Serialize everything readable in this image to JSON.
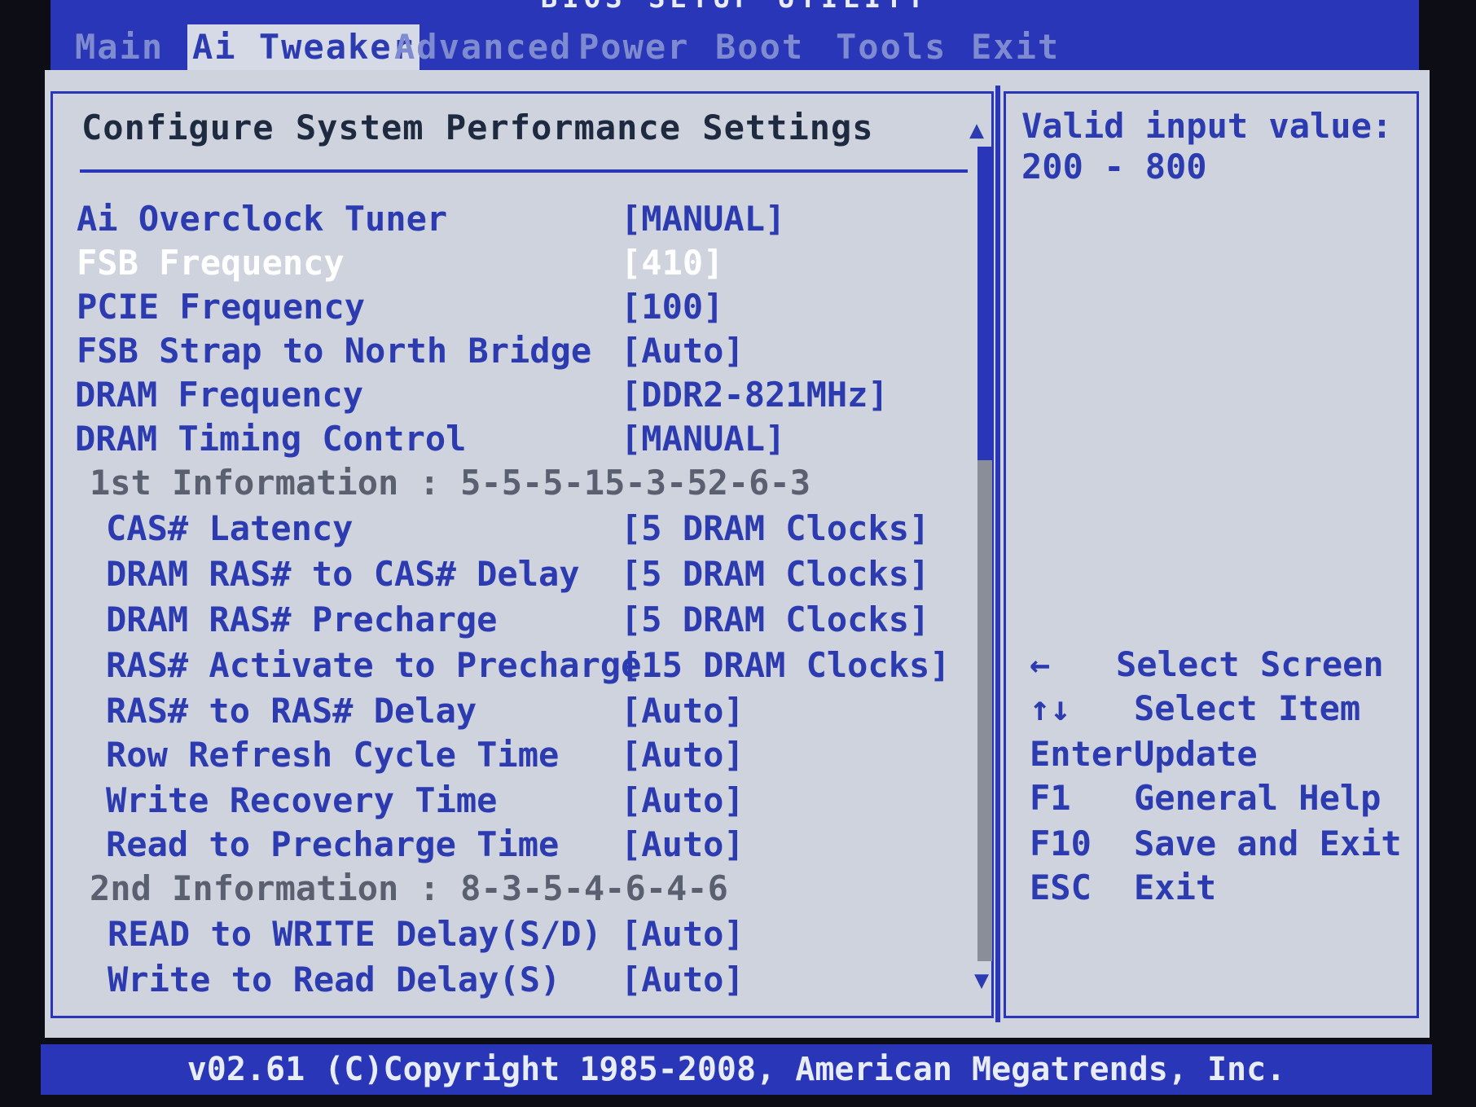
{
  "window": {
    "title": "BIOS SETUP UTILITY"
  },
  "menu": {
    "tabs": [
      {
        "label": "Main"
      },
      {
        "label": "Ai Tweaker"
      },
      {
        "label": "Advanced"
      },
      {
        "label": "Power"
      },
      {
        "label": "Boot"
      },
      {
        "label": "Tools"
      },
      {
        "label": "Exit"
      }
    ],
    "active_tab": "Ai Tweaker"
  },
  "panel": {
    "title": "Configure System Performance Settings",
    "rows": [
      {
        "label": "Ai Overclock Tuner",
        "value": "[MANUAL]"
      },
      {
        "label": "FSB Frequency",
        "value": "[410]"
      },
      {
        "label": "PCIE Frequency",
        "value": "[100]"
      },
      {
        "label": "FSB Strap to North Bridge",
        "value": "[Auto]"
      },
      {
        "label": "DRAM Frequency",
        "value": "[DDR2-821MHz]"
      },
      {
        "label": "DRAM Timing Control",
        "value": "[MANUAL]"
      },
      {
        "label": "1st Information : 5-5-5-15-3-52-6-3",
        "value": ""
      },
      {
        "label": "CAS# Latency",
        "value": "[5 DRAM Clocks]"
      },
      {
        "label": "DRAM RAS# to CAS# Delay",
        "value": "[5 DRAM Clocks]"
      },
      {
        "label": "DRAM RAS# Precharge",
        "value": "[5 DRAM Clocks]"
      },
      {
        "label": "RAS# Activate to Precharge",
        "value": "[15 DRAM Clocks]"
      },
      {
        "label": "RAS# to RAS# Delay",
        "value": "[Auto]"
      },
      {
        "label": "Row Refresh Cycle Time",
        "value": "[Auto]"
      },
      {
        "label": "Write Recovery Time",
        "value": "[Auto]"
      },
      {
        "label": "Read to Precharge Time",
        "value": "[Auto]"
      },
      {
        "label": "2nd Information : 8-3-5-4-6-4-6",
        "value": ""
      },
      {
        "label": "READ to WRITE Delay(S/D)",
        "value": "[Auto]"
      },
      {
        "label": "Write to Read Delay(S)",
        "value": "[Auto]"
      }
    ],
    "selected_row": "FSB Frequency"
  },
  "help": {
    "line1": "Valid input value:",
    "line2": "200 - 800",
    "keys": [
      {
        "key": "←",
        "desc": "Select Screen"
      },
      {
        "key": "↑↓",
        "desc": "Select Item"
      },
      {
        "key": "Enter",
        "desc": "Update"
      },
      {
        "key": "F1",
        "desc": "General Help"
      },
      {
        "key": "F10",
        "desc": "Save and Exit"
      },
      {
        "key": "ESC",
        "desc": "Exit"
      }
    ]
  },
  "scrollbar": {
    "up_glyph": "▲",
    "down_glyph": "▼",
    "position_fraction": 0.0,
    "visible_fraction": 0.38
  },
  "footer": {
    "copyright": "v02.61 (C)Copyright 1985-2008, American Megatrends, Inc."
  },
  "colors": {
    "background": "#cfd3de",
    "accent_blue": "#2a36b8",
    "item_text": "#2c3bb0",
    "selected_text": "#ffffff",
    "info_text": "#5a6070"
  }
}
